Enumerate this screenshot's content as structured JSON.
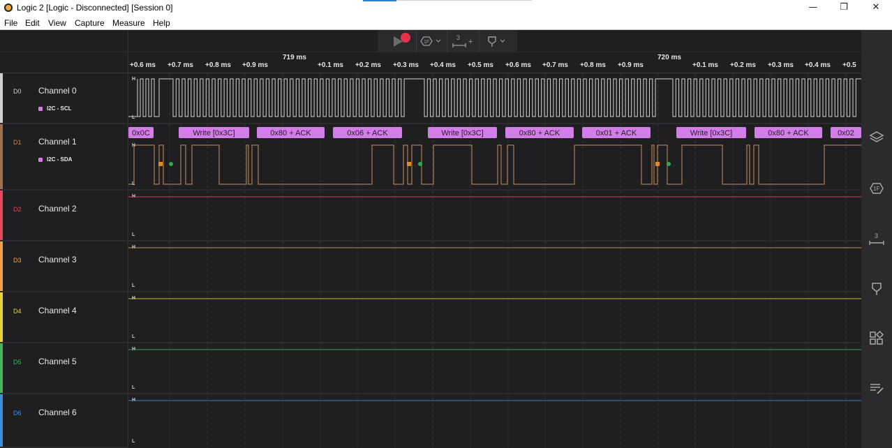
{
  "window": {
    "title": "Logic 2 [Logic - Disconnected] [Session 0]",
    "controls": {
      "minimize": "—",
      "maximize": "❐",
      "close": "✕"
    }
  },
  "menu": [
    "File",
    "Edit",
    "View",
    "Capture",
    "Measure",
    "Help"
  ],
  "toolbar": {
    "play_icon": "play-icon",
    "record_color": "#e8324a",
    "protocol_label": "1F",
    "measure_label": "3",
    "marker_icon": "marker-icon"
  },
  "ruler": {
    "major_labels": [
      {
        "text": "719 ms"
      },
      {
        "text": "720 ms"
      }
    ],
    "ticks": [
      "+0.6 ms",
      "+0.7 ms",
      "+0.8 ms",
      "+0.9 ms",
      "+0.1 ms",
      "+0.2 ms",
      "+0.3 ms",
      "+0.4 ms",
      "+0.5 ms",
      "+0.6 ms",
      "+0.7 ms",
      "+0.8 ms",
      "+0.9 ms",
      "+0.1 ms",
      "+0.2 ms",
      "+0.3 ms",
      "+0.4 ms",
      "+0.5"
    ]
  },
  "channels": [
    {
      "id": "D0",
      "name": "Channel 0",
      "color": "#cfcfcf",
      "analyzer": "I2C - SCL"
    },
    {
      "id": "D1",
      "name": "Channel 1",
      "color": "#a0714f",
      "analyzer": "I2C - SDA"
    },
    {
      "id": "D2",
      "name": "Channel 2",
      "color": "#e8485c"
    },
    {
      "id": "D3",
      "name": "Channel 3",
      "color": "#f0a04a"
    },
    {
      "id": "D4",
      "name": "Channel 4",
      "color": "#e8d43a"
    },
    {
      "id": "D5",
      "name": "Channel 5",
      "color": "#44b35a"
    },
    {
      "id": "D6",
      "name": "Channel 6",
      "color": "#3c8fd8"
    }
  ],
  "level_labels": {
    "high": "H",
    "low": "L"
  },
  "decoded_frames": [
    "0x0C",
    "Write [0x3C]",
    "0x80 + ACK",
    "0x06 + ACK",
    "Write [0x3C]",
    "0x80 + ACK",
    "0x01 + ACK",
    "Write [0x3C]",
    "0x80 + ACK",
    "0x02"
  ],
  "sidebar_icons": [
    "analyzers-icon",
    "protocol-icon",
    "measure-icon",
    "marker-icon",
    "extensions-icon",
    "notes-icon"
  ]
}
